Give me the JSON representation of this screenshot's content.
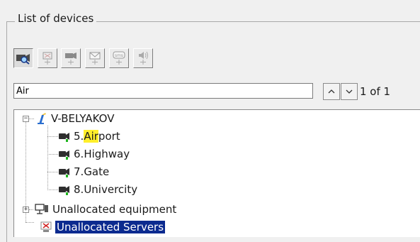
{
  "panel": {
    "title": "List of devices"
  },
  "toolbar": {
    "buttons": [
      {
        "name": "camera-search-icon",
        "active": true
      },
      {
        "name": "add-server-icon",
        "active": false
      },
      {
        "name": "add-camera-icon",
        "active": false
      },
      {
        "name": "add-email-icon",
        "active": false
      },
      {
        "name": "add-sms-icon",
        "active": false
      },
      {
        "name": "add-sound-icon",
        "active": false
      }
    ]
  },
  "search": {
    "value": "Air",
    "result_count": "1 of 1"
  },
  "tree": {
    "root": {
      "label": "V-BELYAKOV",
      "expanded": true
    },
    "cameras": [
      {
        "number": "5. ",
        "match": "Air",
        "rest": "port"
      },
      {
        "number": "6. ",
        "match": "",
        "rest": "Highway"
      },
      {
        "number": "7. ",
        "match": "",
        "rest": "Gate"
      },
      {
        "number": "8. ",
        "match": "",
        "rest": "Univercity"
      }
    ],
    "unallocated_equipment": {
      "label": "Unallocated equipment",
      "expanded": false
    },
    "unallocated_servers": {
      "label": "Unallocated Servers",
      "selected": true
    }
  },
  "colors": {
    "highlight": "#ffef2a",
    "selection": "#0b2a8f"
  }
}
